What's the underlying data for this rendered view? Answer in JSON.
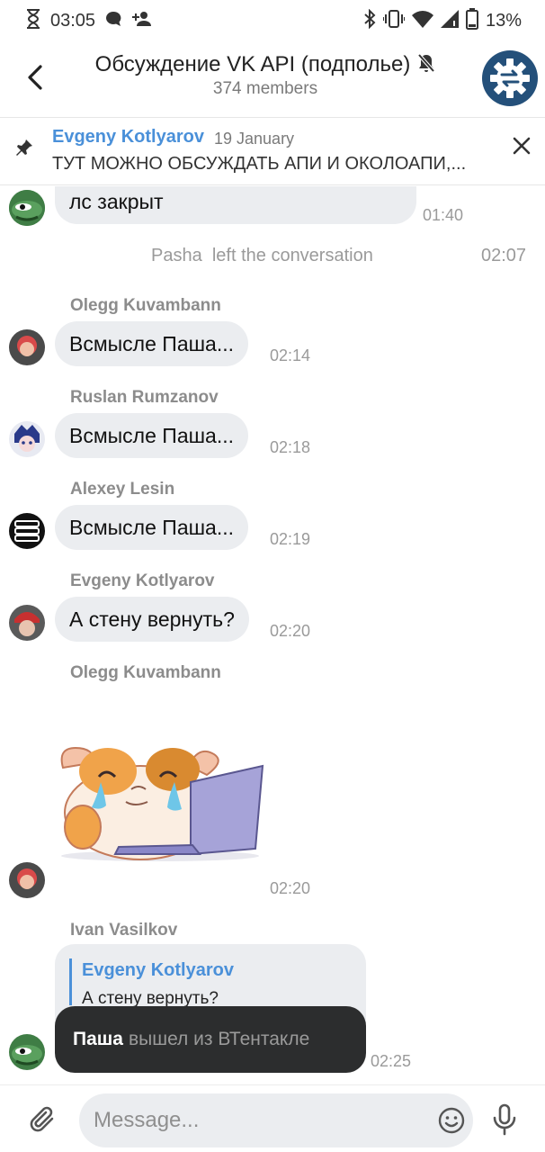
{
  "status_bar": {
    "time": "03:05",
    "battery": "13%",
    "icons": [
      "hourglass-icon",
      "chat-icon",
      "person-add-icon",
      "bluetooth-icon",
      "vibrate-icon",
      "wifi-icon",
      "signal-icon",
      "battery-icon"
    ]
  },
  "header": {
    "title": "Обсуждение VK API (подполье)",
    "subtitle": "374 members",
    "muted": true,
    "avatar_icon": "gear-swap-icon"
  },
  "pinned": {
    "author": "Evgeny Kotlyarov",
    "date": "19 January",
    "text": "ТУТ МОЖНО ОБСУЖДАТЬ АПИ И ОКОЛОАПИ,..."
  },
  "messages": {
    "m0": {
      "text": "лс закрыт",
      "time": "01:40"
    },
    "service": {
      "user": "Pasha",
      "action": "left the conversation",
      "time": "02:07"
    },
    "m1": {
      "sender": "Olegg Kuvambann",
      "text": "Всмысле Паша...",
      "time": "02:14"
    },
    "m2": {
      "sender": "Ruslan Rumzanov",
      "text": "Всмысле Паша...",
      "time": "02:18"
    },
    "m3": {
      "sender": "Alexey Lesin",
      "text": "Всмысле Паша...",
      "time": "02:19"
    },
    "m4": {
      "sender": "Evgeny Kotlyarov",
      "text": "А стену вернуть?",
      "time": "02:20"
    },
    "m5": {
      "sender": "Olegg Kuvambann",
      "sticker": "crying-hamster-laptop-sticker",
      "time": "02:20"
    },
    "m6": {
      "sender": "Ivan Vasilkov",
      "reply_author": "Evgeny Kotlyarov",
      "reply_text": "А стену вернуть?",
      "time": "02:25"
    }
  },
  "toast": {
    "name": "Паша",
    "text": "вышел из ВТентакле"
  },
  "composer": {
    "placeholder": "Message..."
  },
  "colors": {
    "accent": "#4a90d9",
    "bubble": "#ebedf0",
    "toast": "#2c2d2e",
    "chat_avatar": "#24507a"
  }
}
